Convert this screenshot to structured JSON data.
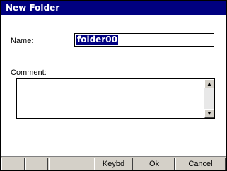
{
  "window": {
    "title": "New Folder"
  },
  "form": {
    "name_label": "Name:",
    "name_value": "folder00",
    "comment_label": "Comment:",
    "comment_value": ""
  },
  "scrollbar": {
    "up_icon": "arrow-up-icon",
    "down_icon": "arrow-down-icon"
  },
  "toolbar": {
    "buttons": [
      "",
      "",
      "Keybd",
      "Ok",
      "Cancel"
    ]
  }
}
